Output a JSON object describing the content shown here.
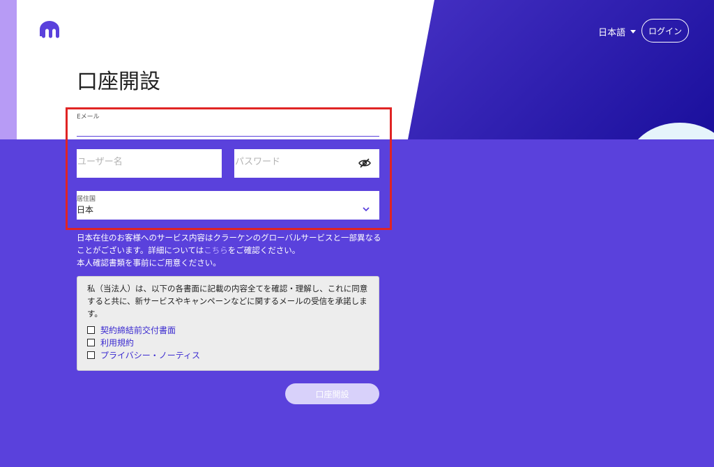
{
  "header": {
    "language_label": "日本語",
    "login_label": "ログイン"
  },
  "page": {
    "title": "口座開設"
  },
  "form": {
    "email_label": "Eメール",
    "username_placeholder": "ユーザー名",
    "password_placeholder": "パスワード",
    "country_label": "居住国",
    "country_value": "日本"
  },
  "notice": {
    "text_before_link": "日本在住のお客様へのサービス内容はクラーケンのグローバルサービスと一部異なることがございます。詳細については",
    "link_text": "こちら",
    "text_after_link": "をご確認ください。",
    "line2": "本人確認書類を事前にご用意ください。"
  },
  "consent": {
    "text": "私（当法人）は、以下の各書面に記載の内容全てを確認・理解し、これに同意すると共に、新サービスやキャンペーンなどに関するメールの受信を承諾します。",
    "items": [
      {
        "label": "契約締結前交付書面"
      },
      {
        "label": "利用規約"
      },
      {
        "label": "プライバシー・ノーティス"
      }
    ]
  },
  "submit_label": "口座開設",
  "icons": {
    "logo": "kraken-logo-icon",
    "language_caret": "caret-down-icon",
    "password_toggle": "eye-slash-icon",
    "country_chevron": "chevron-down-icon"
  },
  "colors": {
    "brand": "#5a41dc",
    "highlight": "#e02424",
    "link": "#3b2bd0"
  }
}
